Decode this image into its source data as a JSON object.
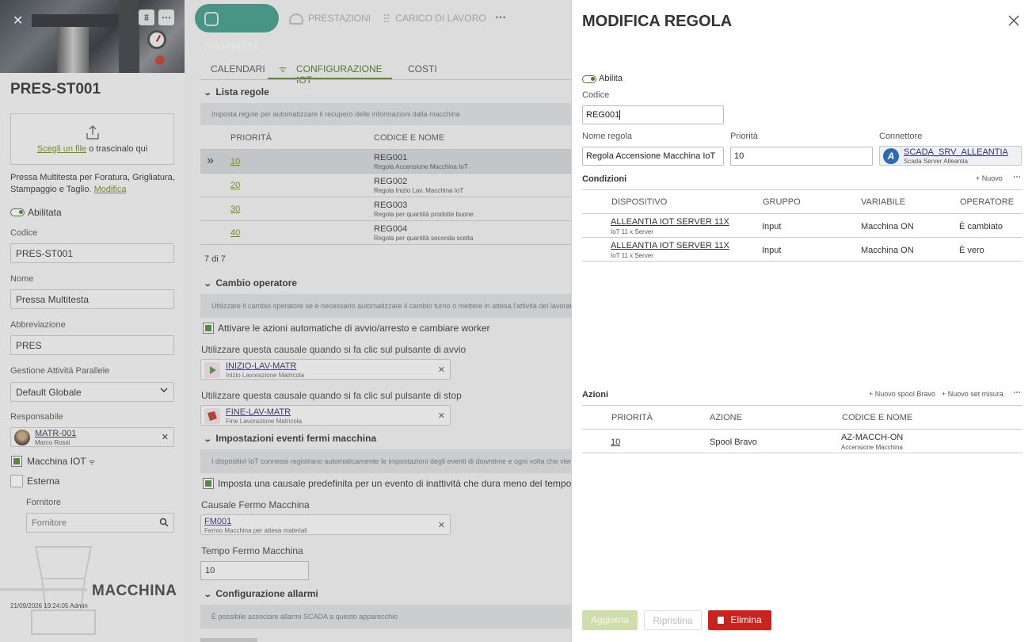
{
  "sidebar": {
    "title": "PRES-ST001",
    "upload_link": "Scegli un file",
    "upload_text": " o trascinalo qui",
    "description": "Pressa Multitesta per Foratura, Grigliatura, Stampaggio e Taglio.",
    "modify_link": "Modifica",
    "enabled_label": "Abilitata",
    "code_label": "Codice",
    "code_value": "PRES-ST001",
    "name_label": "Nome",
    "name_value": "Pressa Multitesta",
    "abbr_label": "Abbreviazione",
    "abbr_value": "PRES",
    "parallel_label": "Gestione Attività Parallele",
    "parallel_value": "Default Globale",
    "responsible_label": "Responsabile",
    "responsible_code": "MATR-001",
    "responsible_name": "Marco Rossi",
    "iot_label": "Macchina IOT",
    "external_label": "Esterna",
    "supplier_label": "Fornitore",
    "supplier_placeholder": "Fornitore",
    "watermark": "MACCHINA",
    "footer": "21/09/2026 19:24:05 Admin"
  },
  "tabs": [
    {
      "label": "PROPRIETÀ",
      "icon": "properties-icon"
    },
    {
      "label": "PRESTAZIONI",
      "icon": "gauge-icon"
    },
    {
      "label": "CARICO DI LAVORO",
      "icon": "grid-icon"
    }
  ],
  "subtabs": {
    "calendars": "CALENDARI",
    "iot": "CONFIGURAZIONE IOT",
    "costs": "COSTI"
  },
  "rules": {
    "title": "Lista regole",
    "info": "Imposta regole per automatizzare il recupero delle informazioni dalla macchina",
    "col_priority": "PRIORITÀ",
    "col_code": "CODICE E NOME",
    "rows": [
      {
        "priority": "10",
        "code": "REG001",
        "name": "Regola Accensione Macchina IoT"
      },
      {
        "priority": "20",
        "code": "REG002",
        "name": "Regola Inizio Lav. Macchina IoT"
      },
      {
        "priority": "30",
        "code": "REG003",
        "name": "Regola per quantità prodotte buone"
      },
      {
        "priority": "40",
        "code": "REG004",
        "name": "Regola per quantità seconda scelta"
      }
    ],
    "count": "7 di 7"
  },
  "operator": {
    "title": "Cambio operatore",
    "info": "Utilizzare il cambio operatore se è necessario automatizzare il cambio turno o mettere in attesa l'attività del lavoratore",
    "check_label": "Attivare le azioni automatiche di avvio/arresto e cambiare worker",
    "start_label": "Utilizzare questa causale quando si fa clic sul pulsante di avvio",
    "start_code": "INIZIO-LAV-MATR",
    "start_name": "Inizio Lavorazione Matricola",
    "stop_label": "Utilizzare questa causale quando si fa clic sul pulsante di stop",
    "stop_code": "FINE-LAV-MATR",
    "stop_name": "Fine Lavorazione Matricola"
  },
  "downtime": {
    "title": "Impostazioni eventi fermi macchina",
    "info": "I dispositivi IoT connessi registrano automaticamente le impostazioni degli eventi di downtime e ogni volta che viene rilevato",
    "check_label": "Imposta una causale predefinita per un evento di inattività che dura meno del tempo specificato",
    "cause_label": "Causale Fermo Macchina",
    "cause_code": "FM001",
    "cause_name": "Fermo Macchina per attesa materiali",
    "time_label": "Tempo Fermo Macchina",
    "time_value": "10"
  },
  "alarms": {
    "title": "Configurazione allarmi",
    "info": "È possibile associare allarmi SCADA a questo apparecchio"
  },
  "panel": {
    "title": "MODIFICA REGOLA",
    "enable_label": "Abilita",
    "code_label": "Codice",
    "code_value": "REG001",
    "name_label": "Nome regola",
    "name_value": "Regola Accensione Macchina IoT",
    "priority_label": "Priorità",
    "priority_value": "10",
    "connector_label": "Connettore",
    "connector_code": "SCADA_SRV_ALLEANTIA",
    "connector_name": "Scada Server Alleantia",
    "conditions": {
      "title": "Condizioni",
      "new_label": "Nuovo",
      "cols": {
        "device": "DISPOSITIVO",
        "group": "GRUPPO",
        "variable": "VARIABILE",
        "operator": "OPERATORE"
      },
      "rows": [
        {
          "device": "ALLEANTIA IOT SERVER 11X",
          "device_sub": "IoT 11 x Server",
          "group": "Input",
          "variable": "Macchina ON",
          "operator": "È cambiato"
        },
        {
          "device": "ALLEANTIA IOT SERVER 11X",
          "device_sub": "IoT 11 x Server",
          "group": "Input",
          "variable": "Macchina ON",
          "operator": "È vero"
        }
      ]
    },
    "actions": {
      "title": "Azioni",
      "new_spool": "Nuovo spool Bravo",
      "new_measure": "Nuovo set misura",
      "cols": {
        "priority": "PRIORITÀ",
        "action": "AZIONE",
        "code": "CODICE E NOME"
      },
      "rows": [
        {
          "priority": "10",
          "action": "Spool Bravo",
          "code": "AZ-MACCH-ON",
          "name": "Accensione Macchina"
        }
      ]
    },
    "buttons": {
      "update": "Aggiorna",
      "restore": "Ripristina",
      "delete": "Elimina"
    }
  }
}
